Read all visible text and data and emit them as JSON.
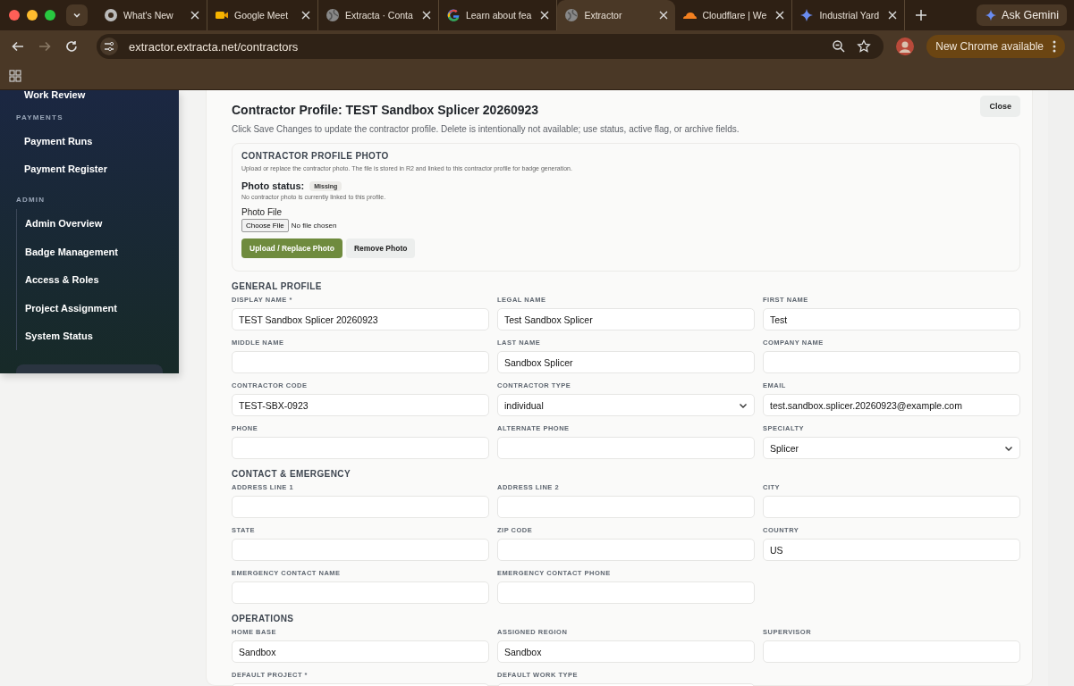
{
  "browser": {
    "tabs": [
      {
        "title": "What's New",
        "selected": false
      },
      {
        "title": "Google Meet",
        "selected": false
      },
      {
        "title": "Extracta · Conta",
        "selected": false
      },
      {
        "title": "Learn about fea",
        "selected": false
      },
      {
        "title": "Extractor",
        "selected": true
      },
      {
        "title": "Cloudflare | We",
        "selected": false
      },
      {
        "title": "Industrial Yard",
        "selected": false
      }
    ],
    "ask_button": "Ask Gemini",
    "url": "extractor.extracta.net/contractors",
    "update_button": "New Chrome available"
  },
  "sidebar": {
    "top_item": "Work Review",
    "groups": [
      {
        "header": "PAYMENTS",
        "items": [
          "Payment Runs",
          "Payment Register"
        ]
      },
      {
        "header": "ADMIN",
        "items": [
          "Admin Overview",
          "Badge Management",
          "Access & Roles",
          "Project Assignment",
          "System Status"
        ]
      }
    ]
  },
  "profile": {
    "title": "Contractor Profile: TEST Sandbox Splicer 20260923",
    "close": "Close",
    "description": "Click Save Changes to update the contractor profile. Delete is intentionally not available; use status, active flag, or archive fields.",
    "photo": {
      "heading": "CONTRACTOR PROFILE PHOTO",
      "note": "Upload or replace the contractor photo. The file is stored in R2 and linked to this contractor profile for badge generation.",
      "status_label": "Photo status:",
      "status": "Missing",
      "status_note": "No contractor photo is currently linked to this profile.",
      "file_label": "Photo File",
      "choose": "Choose File",
      "no_file": "No file chosen",
      "upload": "Upload / Replace Photo",
      "remove": "Remove Photo"
    },
    "sections": [
      {
        "title": "GENERAL PROFILE",
        "fields": [
          {
            "label": "DISPLAY NAME *",
            "value": "TEST Sandbox Splicer 20260923",
            "kind": "text"
          },
          {
            "label": "LEGAL NAME",
            "value": "Test Sandbox Splicer",
            "kind": "text"
          },
          {
            "label": "FIRST NAME",
            "value": "Test",
            "kind": "text"
          },
          {
            "label": "MIDDLE NAME",
            "kind": "text"
          },
          {
            "label": "LAST NAME",
            "value": "Sandbox Splicer",
            "kind": "text"
          },
          {
            "label": "COMPANY NAME",
            "kind": "text"
          },
          {
            "label": "CONTRACTOR CODE",
            "value": "TEST-SBX-0923",
            "kind": "text"
          },
          {
            "label": "CONTRACTOR TYPE",
            "value": "individual",
            "kind": "select"
          },
          {
            "label": "EMAIL",
            "value": "test.sandbox.splicer.20260923@example.com",
            "kind": "text"
          },
          {
            "label": "PHONE",
            "kind": "text"
          },
          {
            "label": "ALTERNATE PHONE",
            "kind": "text"
          },
          {
            "label": "SPECIALTY",
            "value": "Splicer",
            "kind": "select"
          }
        ]
      },
      {
        "title": "CONTACT & EMERGENCY",
        "fields": [
          {
            "label": "ADDRESS LINE 1",
            "kind": "text"
          },
          {
            "label": "ADDRESS LINE 2",
            "kind": "text"
          },
          {
            "label": "CITY",
            "kind": "text"
          },
          {
            "label": "STATE",
            "kind": "text"
          },
          {
            "label": "ZIP CODE",
            "kind": "text"
          },
          {
            "label": "COUNTRY",
            "value": "US",
            "kind": "text"
          },
          {
            "label": "EMERGENCY CONTACT NAME",
            "kind": "text"
          },
          {
            "label": "EMERGENCY CONTACT PHONE",
            "kind": "text"
          }
        ]
      },
      {
        "title": "OPERATIONS",
        "fields": [
          {
            "label": "HOME BASE",
            "value": "Sandbox",
            "kind": "text"
          },
          {
            "label": "ASSIGNED REGION",
            "value": "Sandbox",
            "kind": "text"
          },
          {
            "label": "SUPERVISOR",
            "kind": "text"
          },
          {
            "label": "DEFAULT PROJECT *",
            "kind": "text"
          },
          {
            "label": "DEFAULT WORK TYPE",
            "kind": "text"
          }
        ]
      }
    ]
  }
}
